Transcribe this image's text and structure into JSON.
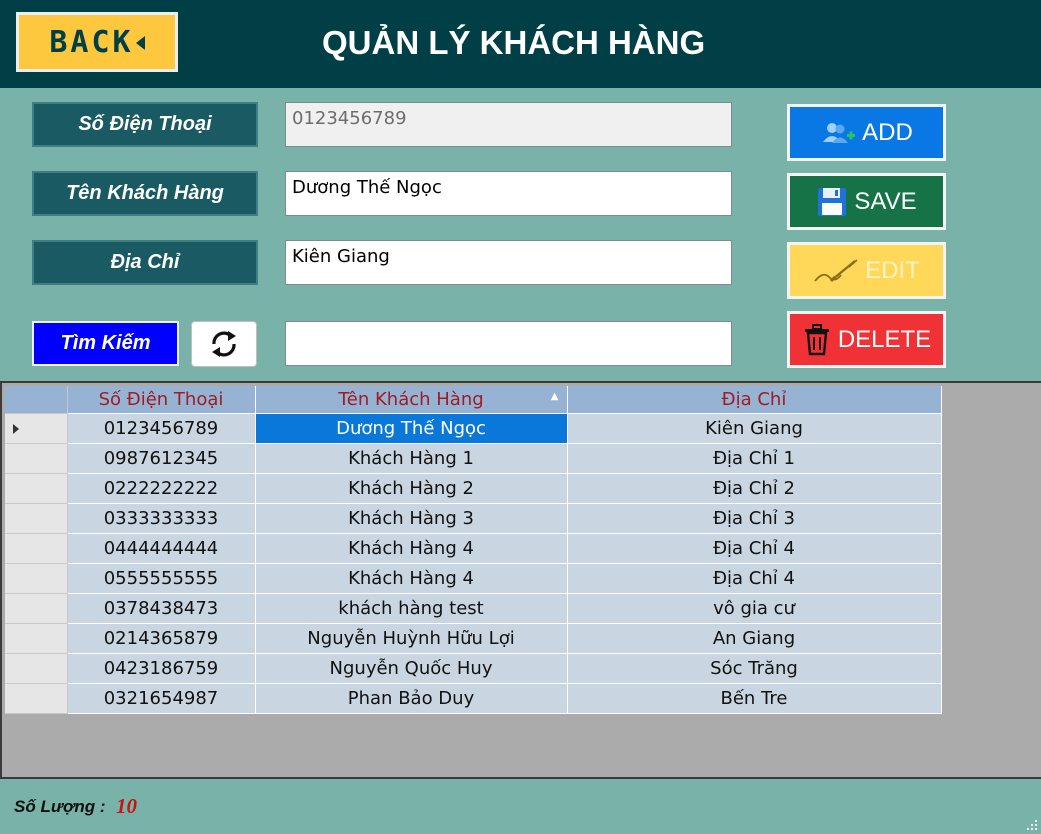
{
  "header": {
    "back_label": "BACK",
    "title": "QUẢN LÝ KHÁCH HÀNG"
  },
  "form": {
    "phone_label": "Số Điện Thoại",
    "phone_value": "0123456789",
    "name_label": "Tên Khách Hàng",
    "name_value": "Dương Thế Ngọc",
    "address_label": "Địa Chỉ",
    "address_value": "Kiên Giang",
    "search_label": "Tìm Kiếm",
    "search_value": ""
  },
  "actions": {
    "add": "ADD",
    "save": "SAVE",
    "edit": "EDIT",
    "delete": "DELETE"
  },
  "grid": {
    "columns": [
      "Số Điện Thoại",
      "Tên Khách Hàng",
      "Địa Chỉ"
    ],
    "rows": [
      [
        "0123456789",
        "Dương Thế Ngọc",
        "Kiên Giang"
      ],
      [
        "0987612345",
        "Khách Hàng 1",
        "Địa Chỉ 1"
      ],
      [
        "0222222222",
        "Khách Hàng 2",
        "Địa Chỉ 2"
      ],
      [
        "0333333333",
        "Khách Hàng 3",
        "Địa Chỉ 3"
      ],
      [
        "0444444444",
        "Khách Hàng 4",
        "Địa Chỉ 4"
      ],
      [
        "0555555555",
        "Khách Hàng 4",
        "Địa Chỉ 4"
      ],
      [
        "0378438473",
        "khách hàng test",
        "vô gia cư"
      ],
      [
        "0214365879",
        "Nguyễn Huỳnh Hữu Lợi",
        "An Giang"
      ],
      [
        "0423186759",
        "Nguyễn Quốc Huy",
        "Sóc Trăng"
      ],
      [
        "0321654987",
        "Phan Bảo Duy",
        "Bến Tre"
      ]
    ]
  },
  "footer": {
    "count_label": "Số Lượng :",
    "count_value": "10"
  },
  "colors": {
    "header_bg": "#003f46",
    "body_bg": "#78b2a9",
    "back_button": "#fdc83d",
    "add": "#0a78e4",
    "save": "#157347",
    "edit": "#ffd85a",
    "delete": "#f03237",
    "search_label": "#0000ff"
  },
  "icons": {
    "back": "left-triangle-icon",
    "refresh": "refresh-icon",
    "add": "add-user-icon",
    "save": "floppy-disk-icon",
    "edit": "pen-write-icon",
    "delete": "trash-icon"
  }
}
